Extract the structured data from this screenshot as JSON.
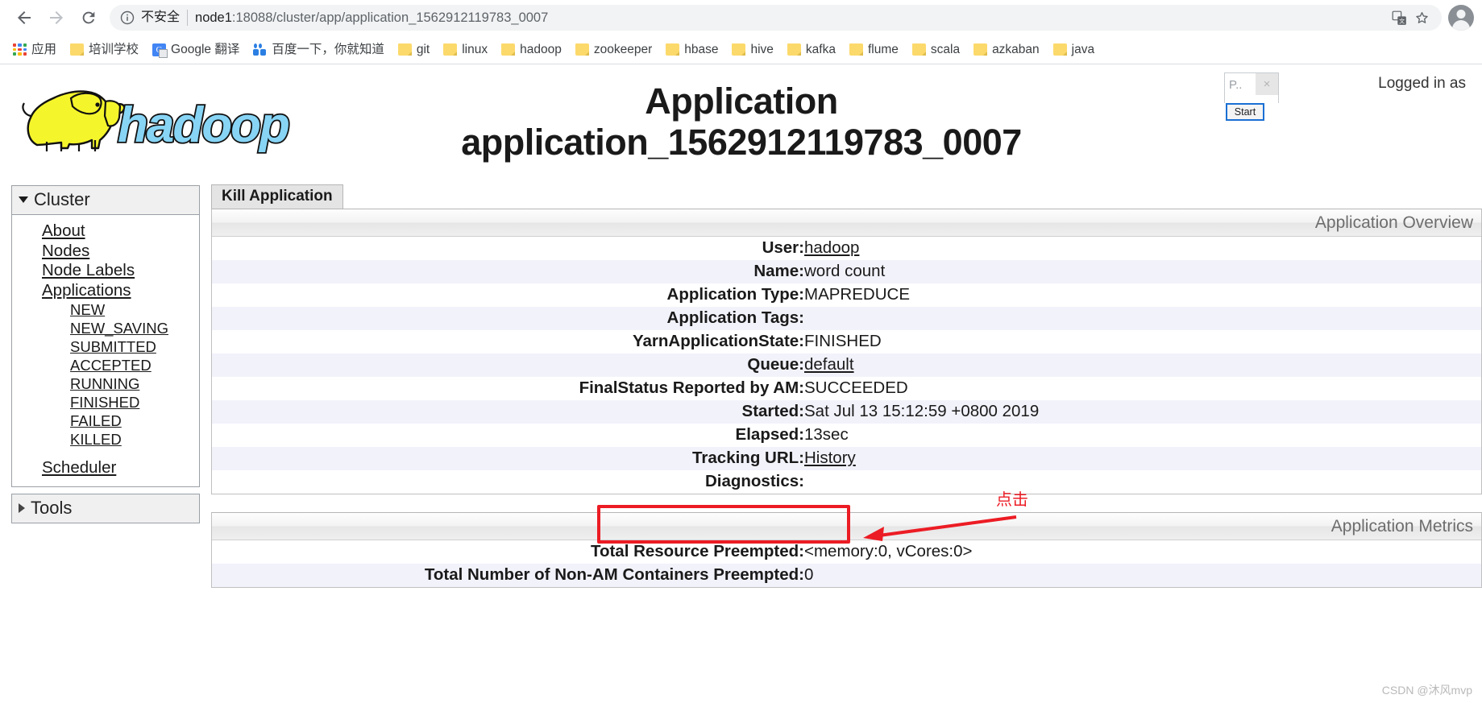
{
  "browser": {
    "back_icon": "back-arrow-icon",
    "forward_icon": "forward-arrow-icon",
    "reload_icon": "reload-icon",
    "info_icon": "info-circle-icon",
    "security_label": "不安全",
    "url_host": "node1",
    "url_rest": ":18088/cluster/app/application_1562912119783_0007",
    "translate_icon": "translate-icon",
    "bookmark_star_icon": "star-icon",
    "profile_icon": "profile-avatar-icon",
    "bookmarks": [
      {
        "label": "应用",
        "icon": "apps-grid-icon"
      },
      {
        "label": "培训学校",
        "icon": "folder-icon"
      },
      {
        "label": "Google 翻译",
        "icon": "google-translate-icon"
      },
      {
        "label": "百度一下，你就知道",
        "icon": "baidu-icon"
      },
      {
        "label": "git",
        "icon": "folder-icon"
      },
      {
        "label": "linux",
        "icon": "folder-icon"
      },
      {
        "label": "hadoop",
        "icon": "folder-icon"
      },
      {
        "label": "zookeeper",
        "icon": "folder-icon"
      },
      {
        "label": "hbase",
        "icon": "folder-icon"
      },
      {
        "label": "hive",
        "icon": "folder-icon"
      },
      {
        "label": "kafka",
        "icon": "folder-icon"
      },
      {
        "label": "flume",
        "icon": "folder-icon"
      },
      {
        "label": "scala",
        "icon": "folder-icon"
      },
      {
        "label": "azkaban",
        "icon": "folder-icon"
      },
      {
        "label": "java",
        "icon": "folder-icon"
      }
    ]
  },
  "header": {
    "logo_text": "hadoop",
    "title_line1": "Application",
    "title_line2": "application_1562912119783_0007",
    "logged_in_as": "Logged in as",
    "popup_label": "P..",
    "popup_close": "×",
    "start_button": "Start"
  },
  "sidebar": {
    "cluster": {
      "title": "Cluster",
      "items": [
        {
          "label": "About",
          "level": 1
        },
        {
          "label": "Nodes",
          "level": 1
        },
        {
          "label": "Node Labels",
          "level": 1
        },
        {
          "label": "Applications",
          "level": 1
        },
        {
          "label": "NEW",
          "level": 2
        },
        {
          "label": "NEW_SAVING",
          "level": 2
        },
        {
          "label": "SUBMITTED",
          "level": 2
        },
        {
          "label": "ACCEPTED",
          "level": 2
        },
        {
          "label": "RUNNING",
          "level": 2
        },
        {
          "label": "FINISHED",
          "level": 2
        },
        {
          "label": "FAILED",
          "level": 2
        },
        {
          "label": "KILLED",
          "level": 2
        },
        {
          "label": "Scheduler",
          "level": 1,
          "spaced": true
        }
      ]
    },
    "tools": {
      "title": "Tools"
    }
  },
  "main": {
    "tab_label": "Kill Application",
    "overview": {
      "caption": "Application Overview",
      "rows": [
        {
          "key": "User:",
          "value": "hadoop",
          "link": true
        },
        {
          "key": "Name:",
          "value": "word count",
          "link": false
        },
        {
          "key": "Application Type:",
          "value": "MAPREDUCE",
          "link": false
        },
        {
          "key": "Application Tags:",
          "value": "",
          "link": false
        },
        {
          "key": "YarnApplicationState:",
          "value": "FINISHED",
          "link": false
        },
        {
          "key": "Queue:",
          "value": "default",
          "link": true
        },
        {
          "key": "FinalStatus Reported by AM:",
          "value": "SUCCEEDED",
          "link": false
        },
        {
          "key": "Started:",
          "value": "Sat Jul 13 15:12:59 +0800 2019",
          "link": false
        },
        {
          "key": "Elapsed:",
          "value": "13sec",
          "link": false
        },
        {
          "key": "Tracking URL:",
          "value": "History",
          "link": true
        },
        {
          "key": "Diagnostics:",
          "value": "",
          "link": false
        }
      ]
    },
    "metrics": {
      "caption": "Application Metrics",
      "rows": [
        {
          "key": "Total Resource Preempted:",
          "value": "<memory:0, vCores:0>",
          "link": false
        },
        {
          "key": "Total Number of Non-AM Containers Preempted:",
          "value": "0",
          "link": false
        }
      ]
    }
  },
  "annotation": {
    "text": "点击",
    "color": "#ec1c24"
  },
  "watermark": "CSDN @沐风mvp"
}
